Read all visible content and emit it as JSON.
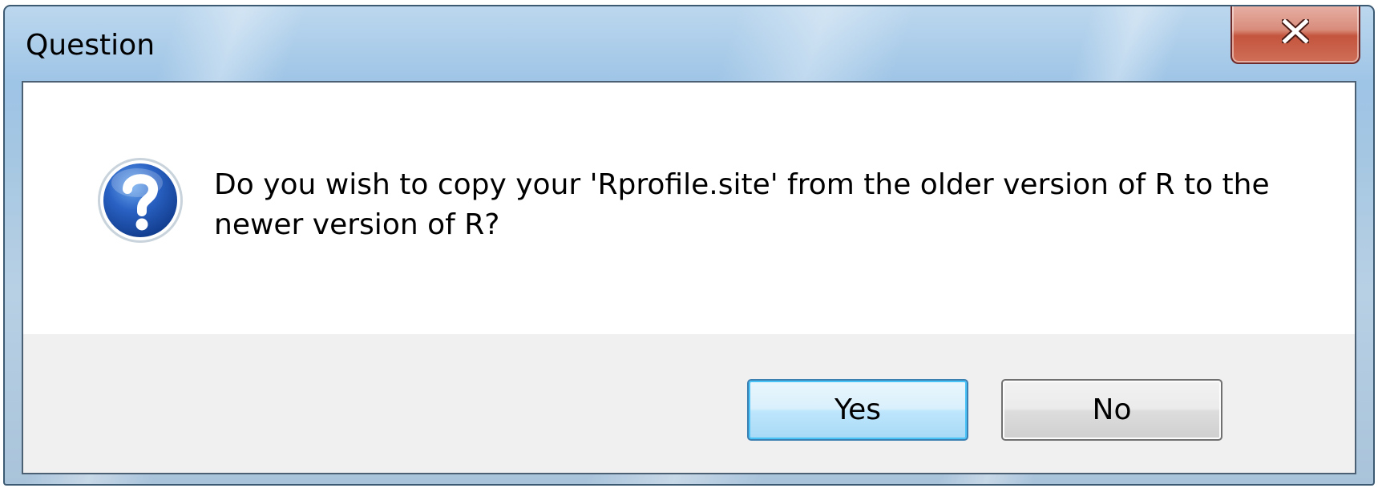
{
  "dialog": {
    "title": "Question",
    "message": "Do you wish to copy your 'Rprofile.site' from the older version of R to the newer version of R?",
    "icon": "question-icon",
    "buttons": {
      "yes_label": "Yes",
      "no_label": "No"
    },
    "close_icon": "close-icon"
  },
  "colors": {
    "close_button": "#c4543d",
    "default_button_border": "#3c7fb1",
    "question_icon": "#1a4fa3"
  }
}
